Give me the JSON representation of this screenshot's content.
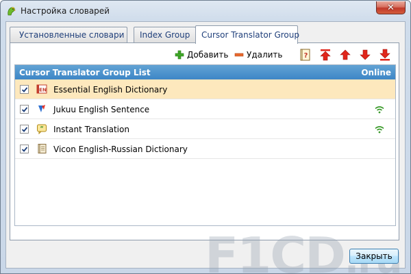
{
  "window": {
    "title": "Настройка словарей"
  },
  "tabs": [
    {
      "label": "Установленные словари",
      "icon": "list-icon"
    },
    {
      "label": "Index Group"
    },
    {
      "label": "Cursor Translator Group",
      "active": true
    }
  ],
  "toolbar": {
    "add_label": "Добавить",
    "delete_label": "Удалить",
    "icons": [
      "dictionary-info-icon",
      "move-top-icon",
      "move-up-icon",
      "move-down-icon",
      "move-bottom-icon"
    ]
  },
  "list": {
    "header_title": "Cursor Translator Group List",
    "header_online": "Online",
    "rows": [
      {
        "label": "Essential English Dictionary",
        "checked": true,
        "selected": true,
        "online": false,
        "icon": "en-book-icon"
      },
      {
        "label": "Jukuu English Sentence",
        "checked": true,
        "selected": false,
        "online": true,
        "icon": "jukuu-icon"
      },
      {
        "label": "Instant Translation",
        "checked": true,
        "selected": false,
        "online": true,
        "icon": "quote-bubble-icon"
      },
      {
        "label": "Vicon English-Russian Dictionary",
        "checked": true,
        "selected": false,
        "online": false,
        "icon": "book-icon"
      }
    ]
  },
  "footer": {
    "close_label": "Закрыть"
  },
  "watermark": {
    "text": "F1CD",
    "suffix": ".ru"
  },
  "colors": {
    "header": "#3d86c6",
    "selected_row": "#fde8bd",
    "online": "#3a9a2a"
  }
}
